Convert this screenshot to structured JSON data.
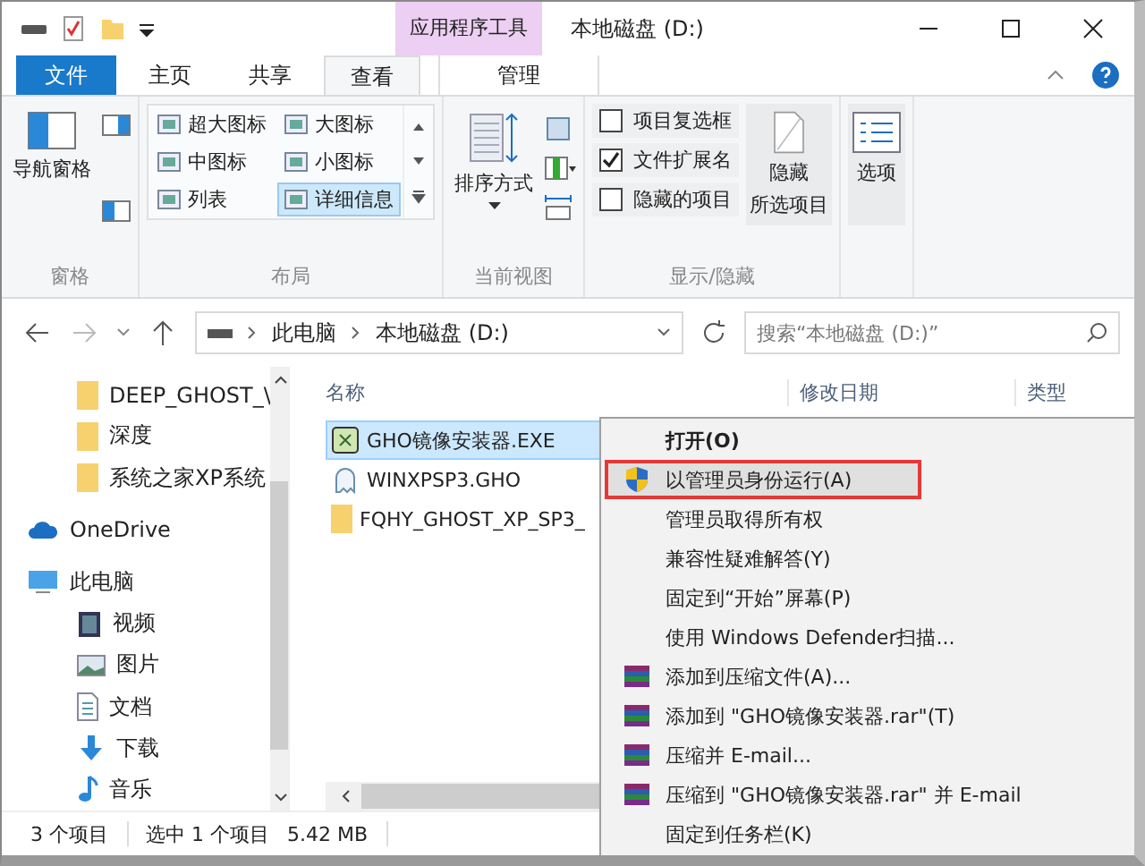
{
  "window": {
    "title": "本地磁盘 (D:)"
  },
  "contextual_tab": {
    "label": "应用程序工具"
  },
  "tabs": [
    {
      "label": "文件",
      "kind": "file",
      "selected": false
    },
    {
      "label": "主页",
      "kind": "tab",
      "selected": false
    },
    {
      "label": "共享",
      "kind": "tab",
      "selected": false
    },
    {
      "label": "查看",
      "kind": "tab",
      "selected": true
    },
    {
      "label": "管理",
      "kind": "contextual",
      "selected": false
    }
  ],
  "ribbon": {
    "pane": {
      "button": "导航窗格",
      "label": "窗格"
    },
    "layout": {
      "label": "布局",
      "items": [
        {
          "label": "超大图标",
          "selected": false
        },
        {
          "label": "大图标",
          "selected": false
        },
        {
          "label": "中图标",
          "selected": false
        },
        {
          "label": "小图标",
          "selected": false
        },
        {
          "label": "列表",
          "selected": false
        },
        {
          "label": "详细信息",
          "selected": true
        }
      ]
    },
    "current_view": {
      "button": "排序方式",
      "label": "当前视图"
    },
    "show_hide": {
      "label": "显示/隐藏",
      "checkboxes": [
        {
          "label": "项目复选框",
          "checked": false
        },
        {
          "label": "文件扩展名",
          "checked": true
        },
        {
          "label": "隐藏的项目",
          "checked": false
        }
      ],
      "hide_button": [
        "隐藏",
        "所选项目"
      ]
    },
    "options": {
      "button": "选项"
    }
  },
  "address": {
    "path": [
      "此电脑",
      "本地磁盘 (D:)"
    ],
    "search": {
      "placeholder": "搜索“本地磁盘 (D:)”"
    }
  },
  "sidebar": {
    "items": [
      {
        "label": "DEEP_GHOST_\\",
        "kind": "folder"
      },
      {
        "label": "深度",
        "kind": "folder"
      },
      {
        "label": "系统之家XP系统",
        "kind": "folder"
      },
      {
        "label": "OneDrive",
        "kind": "cloud"
      },
      {
        "label": "此电脑",
        "kind": "pc",
        "children": [
          {
            "label": "视频",
            "kind": "video"
          },
          {
            "label": "图片",
            "kind": "picture"
          },
          {
            "label": "文档",
            "kind": "document"
          },
          {
            "label": "下载",
            "kind": "download"
          },
          {
            "label": "音乐",
            "kind": "music"
          }
        ]
      }
    ]
  },
  "table": {
    "columns": [
      "名称",
      "修改日期",
      "类型"
    ],
    "rows": [
      {
        "name": "GHO镜像安装器.EXE",
        "kind": "exe",
        "selected": true
      },
      {
        "name": "WINXPSP3.GHO",
        "kind": "ghost",
        "selected": false
      },
      {
        "name": "FQHY_GHOST_XP_SP3_",
        "kind": "folder",
        "selected": false
      }
    ]
  },
  "context_menu": {
    "items": [
      {
        "label": "打开(O)",
        "kind": "default",
        "highlighted": false
      },
      {
        "label": "以管理员身份运行(A)",
        "kind": "shield",
        "highlighted": true
      },
      {
        "label": "管理员取得所有权",
        "kind": "plain",
        "highlighted": false
      },
      {
        "label": "兼容性疑难解答(Y)",
        "kind": "plain",
        "highlighted": false
      },
      {
        "label": "固定到“开始”屏幕(P)",
        "kind": "plain",
        "highlighted": false
      },
      {
        "label": "使用 Windows Defender扫描...",
        "kind": "plain",
        "highlighted": false
      },
      {
        "label": "添加到压缩文件(A)...",
        "kind": "rar",
        "highlighted": false
      },
      {
        "label": "添加到 \"GHO镜像安装器.rar\"(T)",
        "kind": "rar",
        "highlighted": false
      },
      {
        "label": "压缩并 E-mail...",
        "kind": "rar",
        "highlighted": false
      },
      {
        "label": "压缩到 \"GHO镜像安装器.rar\" 并 E-mail",
        "kind": "rar",
        "highlighted": false
      },
      {
        "label": "固定到任务栏(K)",
        "kind": "plain",
        "highlighted": false
      }
    ]
  },
  "status_bar": {
    "count": "3 个项目",
    "selection": "选中 1 个项目",
    "size": "5.42 MB"
  }
}
